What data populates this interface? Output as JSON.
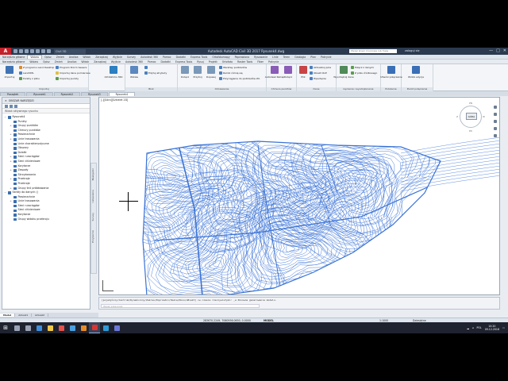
{
  "app": {
    "title": "Autodesk AutoCAD Civil 3D 2017   Rysunek4.dwg",
    "workspace": "Civil 3D",
    "search_placeholder": "Wpisz słowo kluczowe lub frazę",
    "user": "zaloguj się",
    "window_controls": [
      "—",
      "□",
      "✕"
    ],
    "logo_letter": "A"
  },
  "ribbon_tabs": [
    "Narzędzia główne",
    "Wstaw",
    "Opisz",
    "Zmień",
    "Analiza",
    "Widok",
    "Zarządzaj",
    "Wyjście",
    "Survey",
    "Autodesk 360",
    "Pomoc",
    "Dodatki",
    "Express Tools",
    "Ortofotomapy",
    "Poprawiono",
    "Rysowanie",
    "Linie",
    "Teren",
    "Geologia",
    "Plan",
    "Pokrycie"
  ],
  "ribbon_tabs2": [
    "Narzędzia główne",
    "Wstaw",
    "Opisz",
    "Zmień",
    "Analiza",
    "Widok",
    "Zarządzaj",
    "Wyjście",
    "Autodesk 360",
    "Pomoc",
    "Dodatki",
    "Express Tools",
    "Rysuj",
    "Projekt",
    "Ortofoto",
    "Raster Tools",
    "Fiber",
    "Pokrycie"
  ],
  "active_tab_index": 1,
  "ribbon_buttons": {
    "import_label": "Importuj",
    "from_google": "Z programu Land Desktop",
    "landxml": "LandXML",
    "points_file": "Punkty z pliku",
    "storm_sewers": "Program Storm Sewers",
    "import_survey": "Importuj dane pomiarowe",
    "import_points": "Importuj punkty",
    "infraworks": "InfraWorks 360",
    "block": "Wstaw",
    "edit_attr": "Edytuj atrybuty",
    "attach": "Dołącz",
    "clip": "Przytnij",
    "adjust": "Dopasuj",
    "underlay_layers": "Warstwy podkładów",
    "frame": "Ramki różnią się",
    "snap": "Przyciąganie do podkładów Wł.",
    "recap": "Autodesk ReCap",
    "point_cloud": "Dołącz",
    "pdf": "Plik",
    "data_link": "Aktualizuj pola",
    "ole": "Obiekt OLE",
    "hyperlink": "Hiperłącze",
    "extract_data": "Wyodrębnij dane",
    "link_data": "Połącz z danymi",
    "from_source": "Z pliku źródłowego",
    "import_connect": "Utwórz połączenie",
    "win_edit": "Widok edycja"
  },
  "ribbon_panels": [
    "Importuj",
    "Blok",
    "Odniesienie",
    "Chmura punktów",
    "Dane",
    "Łączenie i wyodrębnianie",
    "Położenie",
    "Punkt połączenia"
  ],
  "document_tabs": [
    "Początek",
    "Rysunek1",
    "Rysunek2",
    "Rysunek3",
    "Rysunek4"
  ],
  "active_doc_index": 4,
  "palette": {
    "header": "OBSZAR NARZĘDZI",
    "view_label": "Widok aktywnego rysunku",
    "tree": [
      {
        "label": "Rysunek4",
        "level": 0,
        "toggle": "−"
      },
      {
        "label": "Punkty",
        "level": 1,
        "toggle": ""
      },
      {
        "label": "Grupy punktów",
        "level": 1,
        "toggle": "+"
      },
      {
        "label": "Chmury punktów",
        "level": 1,
        "toggle": ""
      },
      {
        "label": "Powierzchnie",
        "level": 1,
        "toggle": "+"
      },
      {
        "label": "Linie trasowania",
        "level": 1,
        "toggle": "+"
      },
      {
        "label": "Linie charakterystyczne",
        "level": 1,
        "toggle": ""
      },
      {
        "label": "Obszary",
        "level": 1,
        "toggle": ""
      },
      {
        "label": "Działki",
        "level": 1,
        "toggle": ""
      },
      {
        "label": "Sieci rurociągów",
        "level": 1,
        "toggle": "+"
      },
      {
        "label": "Sieci ciśnieniowe",
        "level": 1,
        "toggle": "+"
      },
      {
        "label": "Korytarze",
        "level": 1,
        "toggle": ""
      },
      {
        "label": "Zespoły",
        "level": 1,
        "toggle": "+"
      },
      {
        "label": "Skrzyżowania",
        "level": 1,
        "toggle": ""
      },
      {
        "label": "Przekroje",
        "level": 1,
        "toggle": "+"
      },
      {
        "label": "Przekroje",
        "level": 1,
        "toggle": ""
      },
      {
        "label": "Grupy linii próbkowania",
        "level": 1,
        "toggle": "+"
      },
      {
        "label": "Skróty do danych ()",
        "level": 0,
        "toggle": "−"
      },
      {
        "label": "Powierzchnie",
        "level": 1,
        "toggle": ""
      },
      {
        "label": "Linie trasowania",
        "level": 1,
        "toggle": "+"
      },
      {
        "label": "Sieci rurociągów",
        "level": 1,
        "toggle": ""
      },
      {
        "label": "Sieci ciśnieniowe",
        "level": 1,
        "toggle": ""
      },
      {
        "label": "Korytarze",
        "level": 1,
        "toggle": ""
      },
      {
        "label": "Grupy widoku przekroju",
        "level": 1,
        "toggle": ""
      }
    ]
  },
  "side_tabs": [
    "Nawigator",
    "Ustawienia",
    "Survey",
    "Przybornik"
  ],
  "viewport": {
    "label": "[-][Góra][Szkielet 2D]",
    "viewcube_face": "GÓRA",
    "compass": {
      "n": "PN",
      "s": "PD",
      "w": "Z",
      "e": "W"
    },
    "line_color": "#3a73d6"
  },
  "command": {
    "history1": "[pojedyńczy/Centrum/Dynamiczny/Zakres/Poprzedni/Skala/Okno/oBiekt] <w czasie rzeczywistym>: _e Ponowne generowanie modelu.",
    "history2": "Polecenie:",
    "placeholder": "Wpisz polecenie"
  },
  "layout_tabs": [
    "Model",
    "Arkusz1",
    "Arkusz2"
  ],
  "status": {
    "coords": "283670.2249, 7060956.0650, 0.0000",
    "model": "MODEL",
    "scale": "1:1000",
    "workspace": "Dziesiętne"
  },
  "taskbar": {
    "start_icon": "windows-icon",
    "apps": [
      {
        "name": "search-icon",
        "color": "#9aa3b5"
      },
      {
        "name": "taskview-icon",
        "color": "#9aa3b5"
      },
      {
        "name": "edge-icon",
        "color": "#3f8fdc"
      },
      {
        "name": "explorer-icon",
        "color": "#f2c84b"
      },
      {
        "name": "chrome-icon",
        "color": "#e3524b"
      },
      {
        "name": "store-icon",
        "color": "#4aa0e0"
      },
      {
        "name": "media-icon",
        "color": "#e58b2b"
      },
      {
        "name": "autocad-icon",
        "color": "#d83333"
      },
      {
        "name": "civil3d-icon",
        "color": "#2f9ad6"
      },
      {
        "name": "settings-icon",
        "color": "#6c78d8"
      }
    ],
    "lang": "POL",
    "time": "10:20",
    "date": "09.12.2018"
  }
}
